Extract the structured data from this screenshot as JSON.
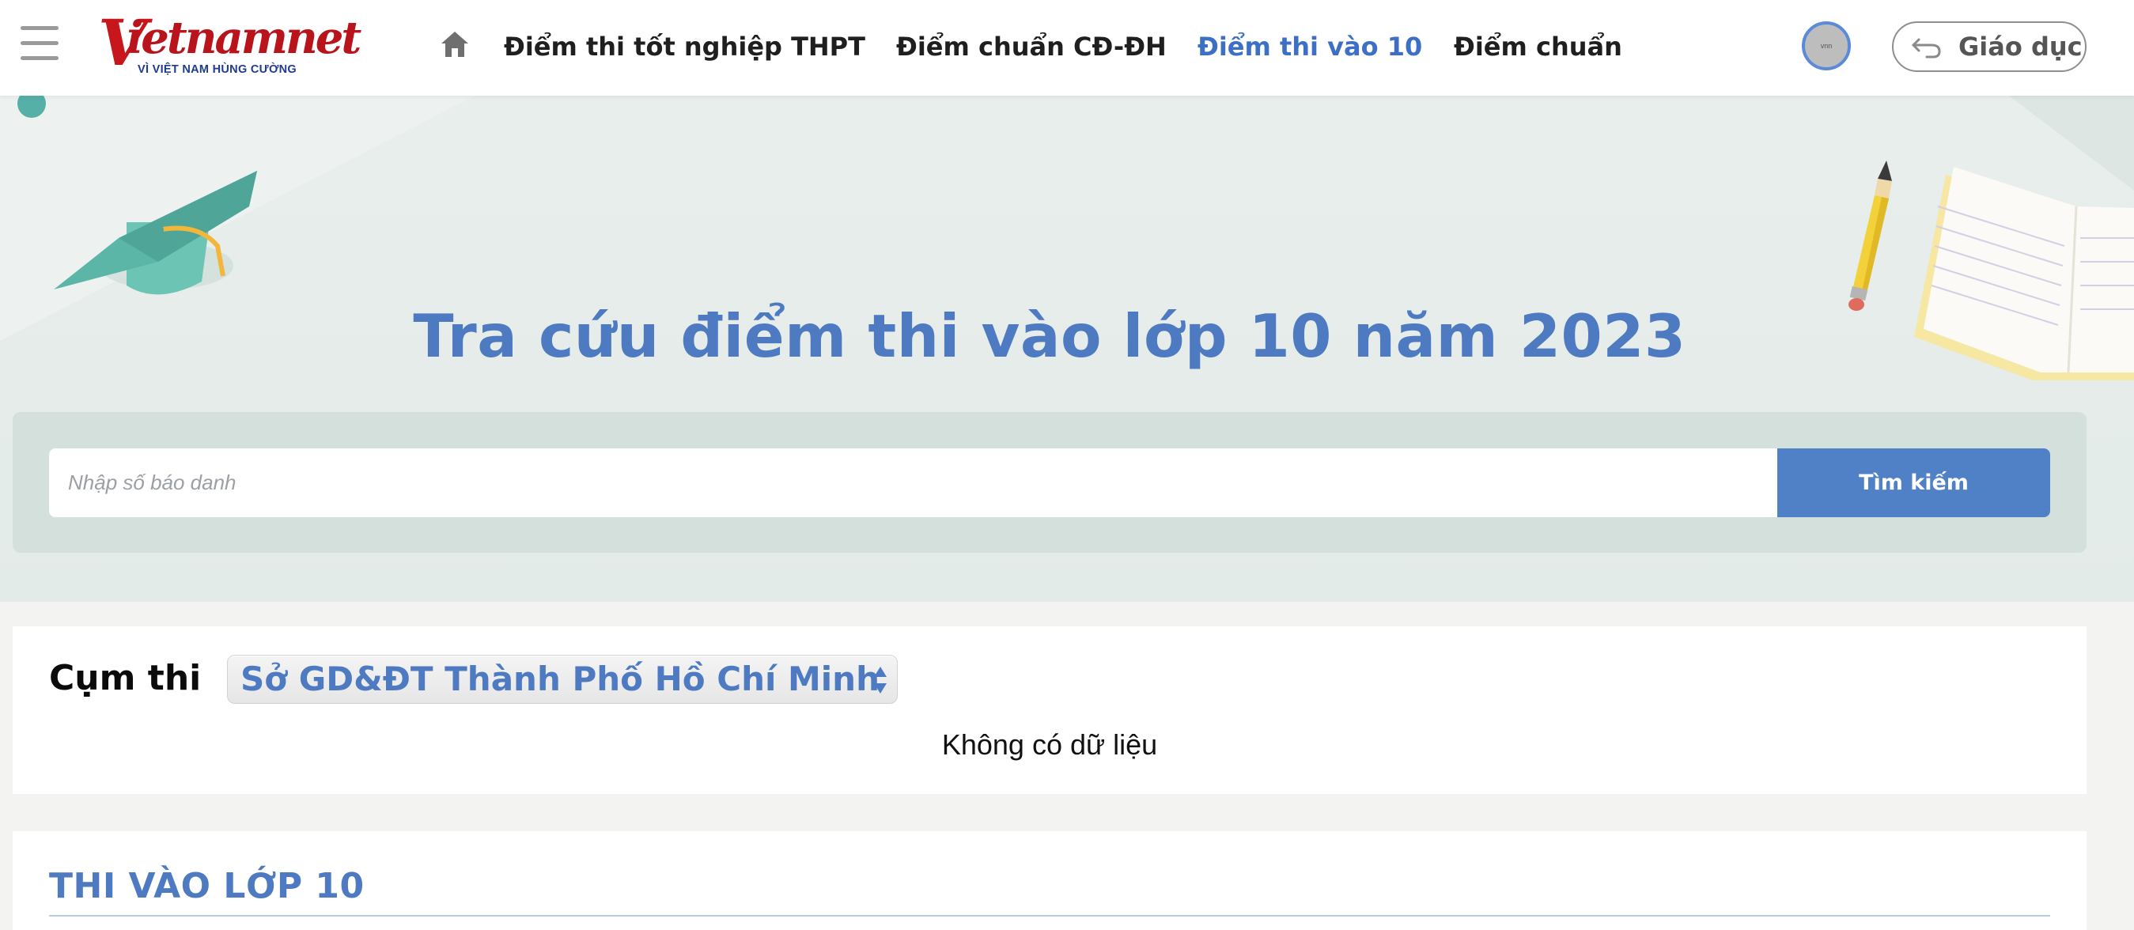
{
  "header": {
    "logo": {
      "brand": "vietnamnet",
      "tagline": "VÌ VIỆT NAM HÙNG CƯỜNG"
    },
    "nav": {
      "items": [
        {
          "label": "Điểm thi tốt nghiệp THPT",
          "active": false
        },
        {
          "label": "Điểm chuẩn CĐ-ĐH",
          "active": false
        },
        {
          "label": "Điểm thi vào 10",
          "active": true
        },
        {
          "label": "Điểm chuẩn",
          "active": false
        }
      ]
    },
    "back_button": {
      "label": "Giáo dục"
    }
  },
  "hero": {
    "title": "Tra cứu điểm thi vào lớp 10 năm 2023"
  },
  "search": {
    "placeholder": "Nhập số báo danh",
    "value": "",
    "button_label": "Tìm kiếm"
  },
  "results": {
    "cluster_label": "Cụm thi",
    "cluster_selected": "Sở GD&ĐT Thành Phố Hồ Chí Minh",
    "empty_message": "Không có dữ liệu"
  },
  "section": {
    "title": "THI VÀO LỚP 10"
  },
  "colors": {
    "accent": "#4e7ac2",
    "button": "#5080c6",
    "logo_red": "#c8161d",
    "panel": "#d4e0dc"
  }
}
